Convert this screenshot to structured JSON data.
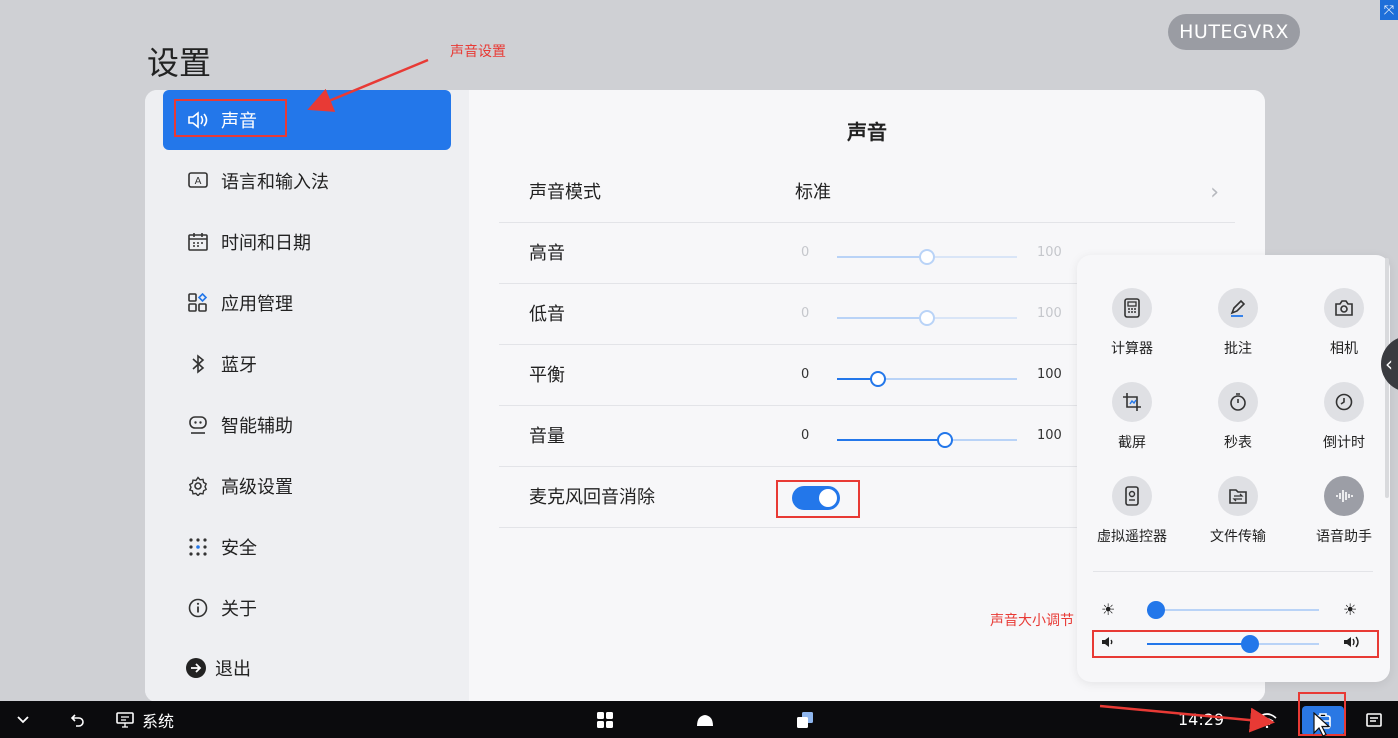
{
  "header": {
    "title": "设置",
    "device_name": "HUTEGVRX"
  },
  "sidebar": {
    "items": [
      {
        "label": "声音",
        "icon": "speaker-icon"
      },
      {
        "label": "语言和输入法",
        "icon": "language-icon"
      },
      {
        "label": "时间和日期",
        "icon": "calendar-icon"
      },
      {
        "label": "应用管理",
        "icon": "apps-icon"
      },
      {
        "label": "蓝牙",
        "icon": "bluetooth-icon"
      },
      {
        "label": "智能辅助",
        "icon": "assist-icon"
      },
      {
        "label": "高级设置",
        "icon": "gear-icon"
      },
      {
        "label": "安全",
        "icon": "security-icon"
      },
      {
        "label": "关于",
        "icon": "info-icon"
      },
      {
        "label": "退出",
        "icon": "exit-icon"
      }
    ]
  },
  "content": {
    "title": "声音",
    "sound_mode": {
      "label": "声音模式",
      "value": "标准"
    },
    "treble": {
      "label": "高音",
      "min": "0",
      "max": "100",
      "value": 50,
      "enabled": false
    },
    "bass": {
      "label": "低音",
      "min": "0",
      "max": "100",
      "value": 50,
      "enabled": false
    },
    "balance": {
      "label": "平衡",
      "min": "0",
      "max": "100",
      "value": 23
    },
    "volume": {
      "label": "音量",
      "min": "0",
      "max": "100",
      "value": 60
    },
    "echo_cancel": {
      "label": "麦克风回音消除",
      "on": true
    }
  },
  "quick_panel": {
    "tiles": [
      {
        "label": "计算器",
        "icon": "calculator-icon"
      },
      {
        "label": "批注",
        "icon": "pen-icon"
      },
      {
        "label": "相机",
        "icon": "camera-icon"
      },
      {
        "label": "截屏",
        "icon": "screenshot-icon"
      },
      {
        "label": "秒表",
        "icon": "stopwatch-icon"
      },
      {
        "label": "倒计时",
        "icon": "countdown-icon"
      },
      {
        "label": "虚拟遥控器",
        "icon": "remote-icon"
      },
      {
        "label": "文件传输",
        "icon": "file-transfer-icon"
      },
      {
        "label": "语音助手",
        "icon": "voice-assistant-icon"
      }
    ],
    "brightness": {
      "value": 0.05
    },
    "volume": {
      "value": 0.6
    }
  },
  "taskbar": {
    "app_label": "系统",
    "time": "14:29"
  },
  "annotations": {
    "sound_settings": "声音设置",
    "volume_adjust": "声音大小调节"
  },
  "colors": {
    "accent": "#2377ea",
    "annotation": "#e83a35",
    "taskbar": "#0b0b0d"
  }
}
